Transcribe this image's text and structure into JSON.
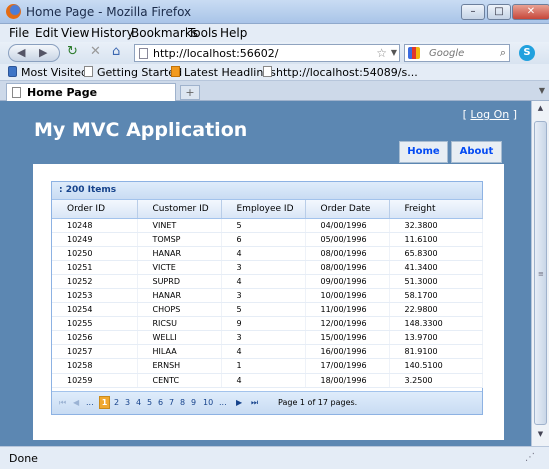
{
  "window": {
    "title": "Home Page - Mozilla Firefox"
  },
  "menu": [
    "File",
    "Edit",
    "View",
    "History",
    "Bookmarks",
    "Tools",
    "Help"
  ],
  "nav": {
    "url": "http://localhost:56602/",
    "search_placeholder": "Google"
  },
  "bookmarks": [
    "Most Visited",
    "Getting Started",
    "Latest Headlines",
    "http://localhost:54089/s..."
  ],
  "tab": {
    "label": "Home Page"
  },
  "site": {
    "login_open": "[",
    "login_link": "Log On",
    "login_close": "]",
    "title": "My MVC Application",
    "menu": [
      "Home",
      "About"
    ]
  },
  "grid": {
    "caption": ": 200 Items",
    "columns": [
      "Order ID",
      "Customer ID",
      "Employee ID",
      "Order Date",
      "Freight"
    ],
    "rows": [
      [
        "10248",
        "VINET",
        "5",
        "04/00/1996",
        "32.3800"
      ],
      [
        "10249",
        "TOMSP",
        "6",
        "05/00/1996",
        "11.6100"
      ],
      [
        "10250",
        "HANAR",
        "4",
        "08/00/1996",
        "65.8300"
      ],
      [
        "10251",
        "VICTE",
        "3",
        "08/00/1996",
        "41.3400"
      ],
      [
        "10252",
        "SUPRD",
        "4",
        "09/00/1996",
        "51.3000"
      ],
      [
        "10253",
        "HANAR",
        "3",
        "10/00/1996",
        "58.1700"
      ],
      [
        "10254",
        "CHOPS",
        "5",
        "11/00/1996",
        "22.9800"
      ],
      [
        "10255",
        "RICSU",
        "9",
        "12/00/1996",
        "148.3300"
      ],
      [
        "10256",
        "WELLI",
        "3",
        "15/00/1996",
        "13.9700"
      ],
      [
        "10257",
        "HILAA",
        "4",
        "16/00/1996",
        "81.9100"
      ],
      [
        "10258",
        "ERNSH",
        "1",
        "17/00/1996",
        "140.5100"
      ],
      [
        "10259",
        "CENTC",
        "4",
        "18/00/1996",
        "3.2500"
      ]
    ],
    "pager": {
      "first": "⏮",
      "prev": "◀",
      "ellipsis_left": "...",
      "pages": [
        "1",
        "2",
        "3",
        "4",
        "5",
        "6",
        "7",
        "8",
        "9",
        "10"
      ],
      "ellipsis_right": "...",
      "next": "▶",
      "last": "⏭",
      "current": "1",
      "info": "Page 1 of 17 pages."
    }
  },
  "status": {
    "text": "Done"
  }
}
